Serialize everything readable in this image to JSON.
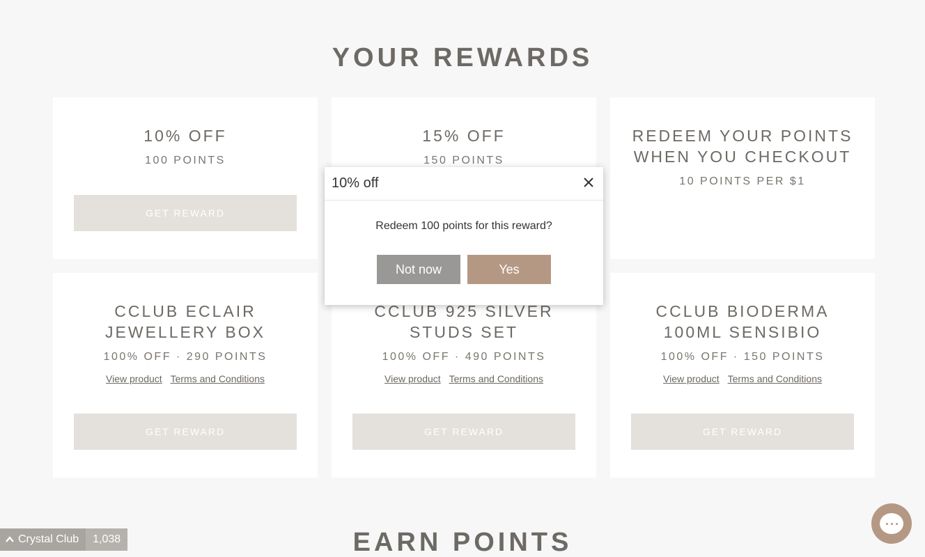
{
  "rewards_section": {
    "title": "YOUR REWARDS",
    "cards": [
      {
        "title_line1": "10% OFF",
        "title_line2": "",
        "sub": "100 POINTS",
        "button": "GET REWARD"
      },
      {
        "title_line1": "15% OFF",
        "title_line2": "",
        "sub": "150 POINTS"
      },
      {
        "title_line1": "REDEEM YOUR POINTS",
        "title_line2": "WHEN YOU CHECKOUT",
        "sub": "10 POINTS PER $1"
      },
      {
        "title_line1": "CCLUB ECLAIR",
        "title_line2": "JEWELLERY BOX",
        "sub": "100% OFF · 290 POINTS",
        "view_link": "View product",
        "terms_link": "Terms and Conditions",
        "button": "GET REWARD"
      },
      {
        "title_line1": "CCLUB 925 SILVER",
        "title_line2": "STUDS SET",
        "sub": "100% OFF · 490 POINTS",
        "view_link": "View product",
        "terms_link": "Terms and Conditions",
        "button": "GET REWARD"
      },
      {
        "title_line1": "CCLUB BIODERMA",
        "title_line2": "100ML SENSIBIO",
        "sub": "100% OFF · 150 POINTS",
        "view_link": "View product",
        "terms_link": "Terms and Conditions",
        "button": "GET REWARD"
      }
    ]
  },
  "earn_section": {
    "title": "EARN POINTS"
  },
  "modal": {
    "title": "10% off",
    "close_icon": "close-icon",
    "message": "Redeem 100 points for this reward?",
    "not_now": "Not now",
    "yes": "Yes"
  },
  "launcher": {
    "icon": "chevron-up-icon",
    "label": "Crystal Club",
    "points": "1,038"
  },
  "chat": {
    "icon": "chat-bubble-icon"
  },
  "colors": {
    "background": "#f7f7f7",
    "button_disabled": "#e4e0dc",
    "accent": "#b59884",
    "secondary_button": "#999896"
  }
}
